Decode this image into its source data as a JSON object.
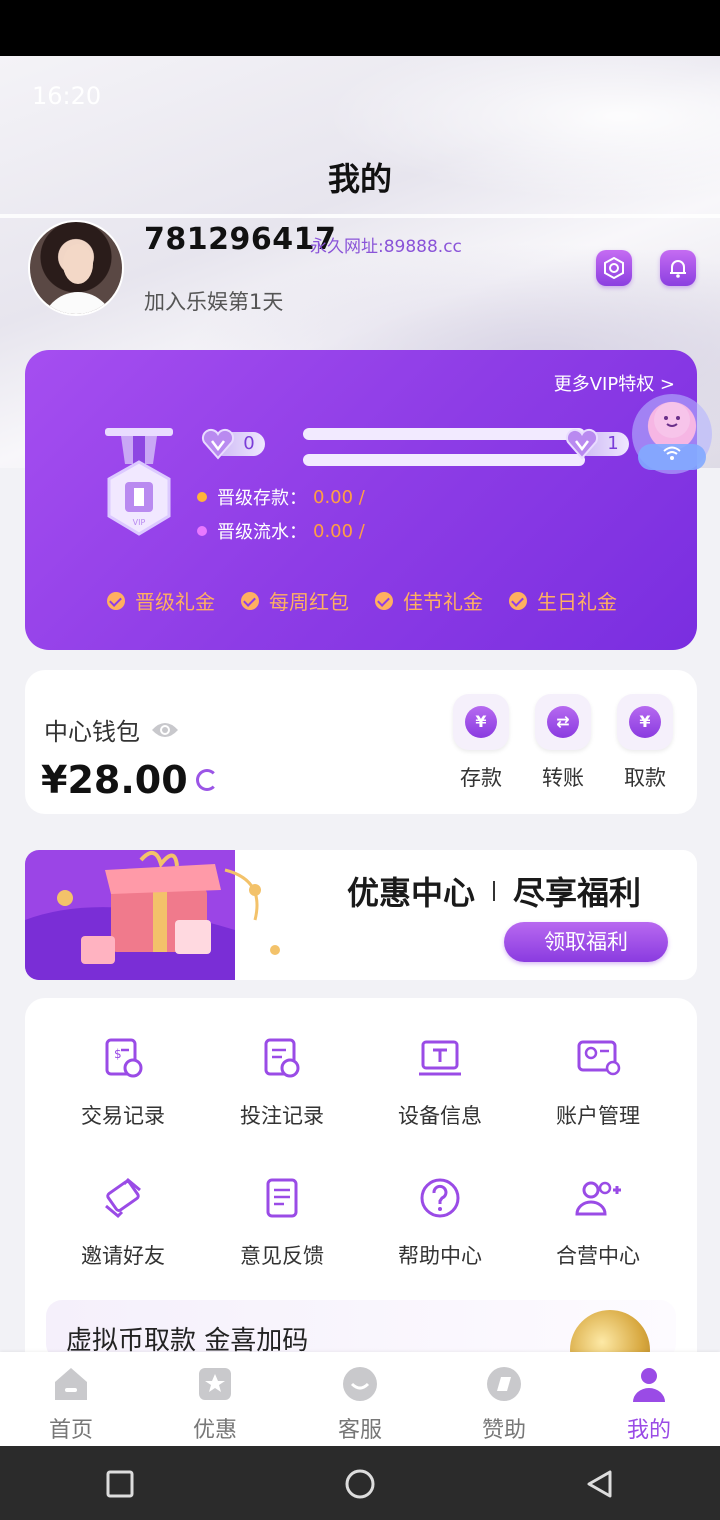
{
  "status_bar": {
    "time": "16:20"
  },
  "header": {
    "title": "我的"
  },
  "profile": {
    "username": "781296417",
    "permalink": "永久网址:89888.cc",
    "join_info": "加入乐娱第1天"
  },
  "vip": {
    "more_link": "更多VIP特权 >",
    "current_level": "0",
    "next_level": "1",
    "deposit_label": "晋级存款：",
    "deposit_value": "0.00 /",
    "turnover_label": "晋级流水：",
    "turnover_value": "0.00 /",
    "perks": [
      "晋级礼金",
      "每周红包",
      "佳节礼金",
      "生日礼金"
    ]
  },
  "wallet": {
    "title": "中心钱包",
    "balance": "¥28.00",
    "actions": [
      {
        "label": "存款",
        "icon": "deposit-icon"
      },
      {
        "label": "转账",
        "icon": "transfer-icon"
      },
      {
        "label": "取款",
        "icon": "withdraw-icon"
      }
    ]
  },
  "promo": {
    "title_left": "优惠中心",
    "title_right": "尽享福利",
    "button": "领取福利"
  },
  "menu": {
    "items": [
      {
        "label": "交易记录",
        "icon": "transaction-record-icon"
      },
      {
        "label": "投注记录",
        "icon": "bet-record-icon"
      },
      {
        "label": "设备信息",
        "icon": "device-info-icon"
      },
      {
        "label": "账户管理",
        "icon": "account-manage-icon"
      },
      {
        "label": "邀请好友",
        "icon": "invite-friends-icon"
      },
      {
        "label": "意见反馈",
        "icon": "feedback-icon"
      },
      {
        "label": "帮助中心",
        "icon": "help-center-icon"
      },
      {
        "label": "合营中心",
        "icon": "partner-center-icon"
      }
    ]
  },
  "crypto_banner": {
    "text": "虚拟币取款  金喜加码"
  },
  "tabbar": {
    "tabs": [
      {
        "label": "首页",
        "icon": "home-icon"
      },
      {
        "label": "优惠",
        "icon": "promo-icon"
      },
      {
        "label": "客服",
        "icon": "support-icon"
      },
      {
        "label": "赞助",
        "icon": "sponsor-icon"
      },
      {
        "label": "我的",
        "icon": "profile-icon"
      }
    ],
    "active": "我的"
  },
  "colors": {
    "accent": "#9a4be6",
    "vip_card": "#8e3de6",
    "perk": "#ffb060",
    "deposit_value": "#ff9f43"
  }
}
